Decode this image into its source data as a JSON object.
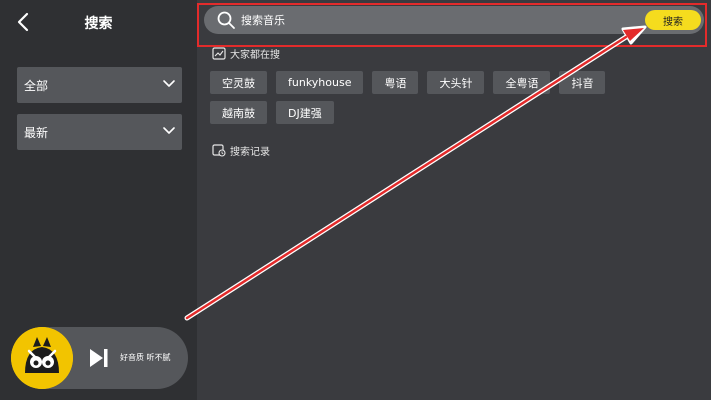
{
  "header": {
    "title": "搜索"
  },
  "filters": {
    "category": {
      "value": "全部"
    },
    "sort": {
      "value": "最新"
    }
  },
  "search": {
    "placeholder": "搜索音乐",
    "button_label": "搜索"
  },
  "hot": {
    "label": "大家都在搜",
    "tags": [
      "空灵鼓",
      "funkyhouse",
      "粤语",
      "大头针",
      "全粤语",
      "抖音",
      "越南鼓",
      "DJ建强"
    ]
  },
  "history": {
    "label": "搜索记录"
  },
  "player": {
    "now_playing": "好音质 听不腻"
  },
  "colors": {
    "accent": "#f5dc1e",
    "annotation": "#e32b2b"
  }
}
